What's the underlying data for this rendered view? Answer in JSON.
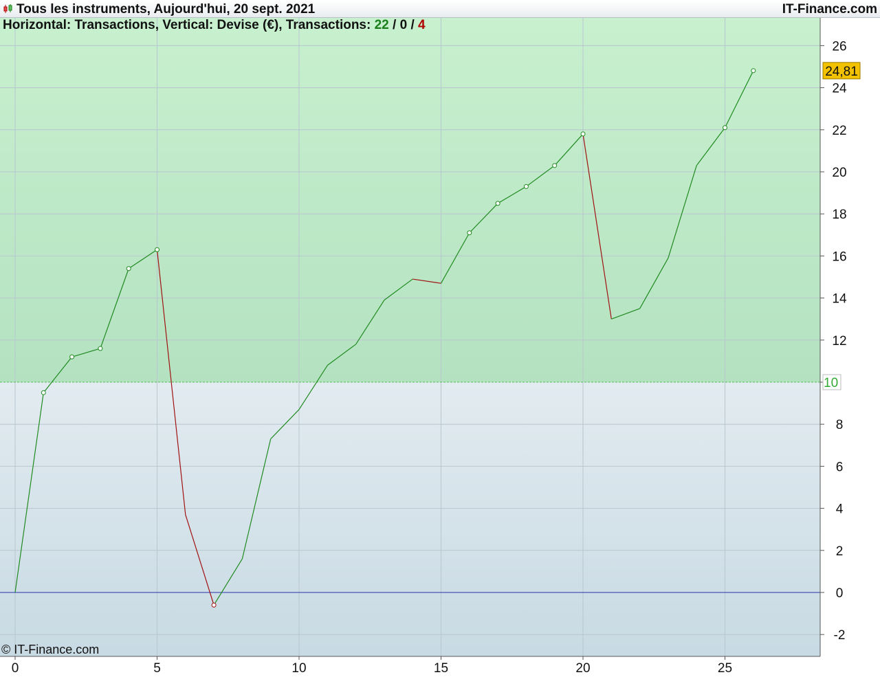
{
  "header": {
    "title": "Tous les instruments, Aujourd'hui, 20 sept. 2021",
    "brand": "IT-Finance.com"
  },
  "subtitle": {
    "prefix": "Horizontal: Transactions, Vertical: Devise (€), Transactions: ",
    "wins": "22",
    "sep1": " / ",
    "neutral": "0",
    "sep2": " / ",
    "losses": "4"
  },
  "footer": {
    "copyright": "© IT-Finance.com"
  },
  "colors": {
    "profit_zone_top": "#c8f0cf",
    "profit_zone_bottom": "#b4e2c1",
    "loss_zone_top": "#e2ebf0",
    "loss_zone_bottom": "#c8dae3",
    "up_line": "#1f8a1f",
    "down_line": "#a01010",
    "zero_line": "#2233aa",
    "threshold_line": "#55bb55",
    "last_value_bg": "#f2c200",
    "threshold_label": "#33aa33"
  },
  "chart_data": {
    "type": "line",
    "xlabel": "",
    "ylabel": "",
    "xlim": [
      -0.5,
      28.3
    ],
    "ylim": [
      -3,
      27.5
    ],
    "x_ticks": [
      0,
      5,
      10,
      15,
      20,
      25
    ],
    "y_ticks": [
      -2,
      0,
      2,
      4,
      6,
      8,
      10,
      12,
      14,
      16,
      18,
      20,
      22,
      24,
      26
    ],
    "grid": true,
    "threshold": 10,
    "threshold_label": "10",
    "zero_line": 0,
    "last_value_label": "24,81",
    "series": [
      {
        "x": [
          0,
          1,
          2,
          3,
          4,
          5,
          6,
          7,
          8,
          9,
          10,
          11,
          12,
          13,
          14,
          15,
          16,
          17,
          18,
          19,
          20,
          21,
          22,
          23,
          24,
          25,
          26
        ],
        "values": [
          0,
          9.5,
          11.2,
          11.6,
          15.4,
          16.3,
          3.7,
          -0.6,
          1.6,
          7.3,
          8.7,
          10.8,
          11.8,
          13.9,
          14.9,
          14.7,
          17.1,
          18.5,
          19.3,
          20.3,
          21.8,
          13.0,
          13.5,
          15.9,
          20.3,
          22.1,
          24.81
        ],
        "markers": [
          1,
          2,
          3,
          4,
          5,
          7,
          16,
          17,
          18,
          19,
          20,
          25,
          26
        ]
      }
    ]
  }
}
